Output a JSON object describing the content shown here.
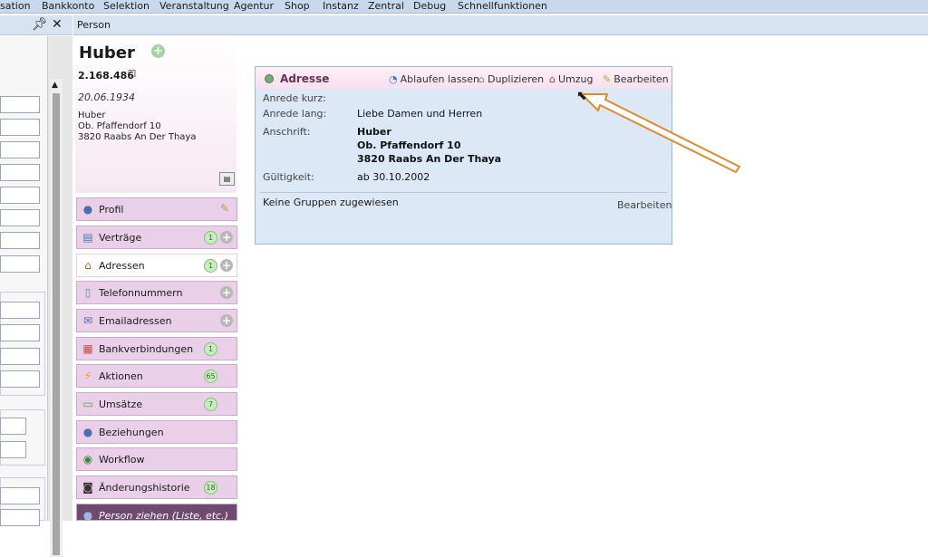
{
  "menu": [
    "sation",
    "Bankkonto",
    "Selektion",
    "Veranstaltung",
    "Agentur",
    "Shop",
    "Instanz",
    "Zentral",
    "Debug",
    "Schnellfunktionen"
  ],
  "left_panel": {
    "pin_icon": "pin-icon",
    "close_icon": "close-icon"
  },
  "tab": {
    "title": "Person"
  },
  "person": {
    "name": "Huber",
    "number": "2.168.486",
    "dob": "20.06.1934",
    "address_lines": [
      "Huber",
      "Ob. Pfaffendorf 10",
      "3820 Raabs An Der Thaya"
    ]
  },
  "nav": [
    {
      "label": "Profil",
      "icon": "person-icon",
      "count": "",
      "add": false,
      "edit": true
    },
    {
      "label": "Verträge",
      "icon": "contract-icon",
      "count": "1",
      "add": true
    },
    {
      "label": "Adressen",
      "icon": "house-icon",
      "count": "1",
      "add": true,
      "active": true
    },
    {
      "label": "Telefonnummern",
      "icon": "phone-icon",
      "count": "",
      "add": true
    },
    {
      "label": "Emailadressen",
      "icon": "mail-icon",
      "count": "",
      "add": true
    },
    {
      "label": "Bankverbindungen",
      "icon": "bank-icon",
      "count": "1",
      "add": false
    },
    {
      "label": "Aktionen",
      "icon": "bolt-icon",
      "count": "65",
      "add": false
    },
    {
      "label": "Umsätze",
      "icon": "money-icon",
      "count": "7",
      "add": false
    },
    {
      "label": "Beziehungen",
      "icon": "people-icon",
      "count": "",
      "add": false
    },
    {
      "label": "Workflow",
      "icon": "workflow-icon",
      "count": "",
      "add": false
    },
    {
      "label": "Änderungshistorie",
      "icon": "history-icon",
      "count": "18",
      "add": false
    },
    {
      "label": "Person ziehen (Liste, etc.)",
      "icon": "drag-person-icon",
      "count": "",
      "add": false
    }
  ],
  "address_card": {
    "title": "Adresse",
    "actions": [
      "Ablaufen lassen",
      "Duplizieren",
      "Umzug",
      "Bearbeiten"
    ],
    "fields": {
      "anrede_kurz_label": "Anrede kurz:",
      "anrede_lang_label": "Anrede lang:",
      "anrede_lang_value": "Liebe Damen und Herren",
      "anschrift_label": "Anschrift:",
      "anschrift_lines": [
        "Huber",
        "Ob. Pfaffendorf 10",
        "3820 Raabs An Der Thaya"
      ],
      "gueltigkeit_label": "Gültigkeit:",
      "gueltigkeit_value": "ab 30.10.2002"
    },
    "groups_text": "Keine Gruppen zugewiesen",
    "groups_edit": "Bearbeiten"
  },
  "colors": {
    "arrow": "#e08a2c",
    "accent": "#6a2f55",
    "card_bg": "#dce8f6"
  }
}
